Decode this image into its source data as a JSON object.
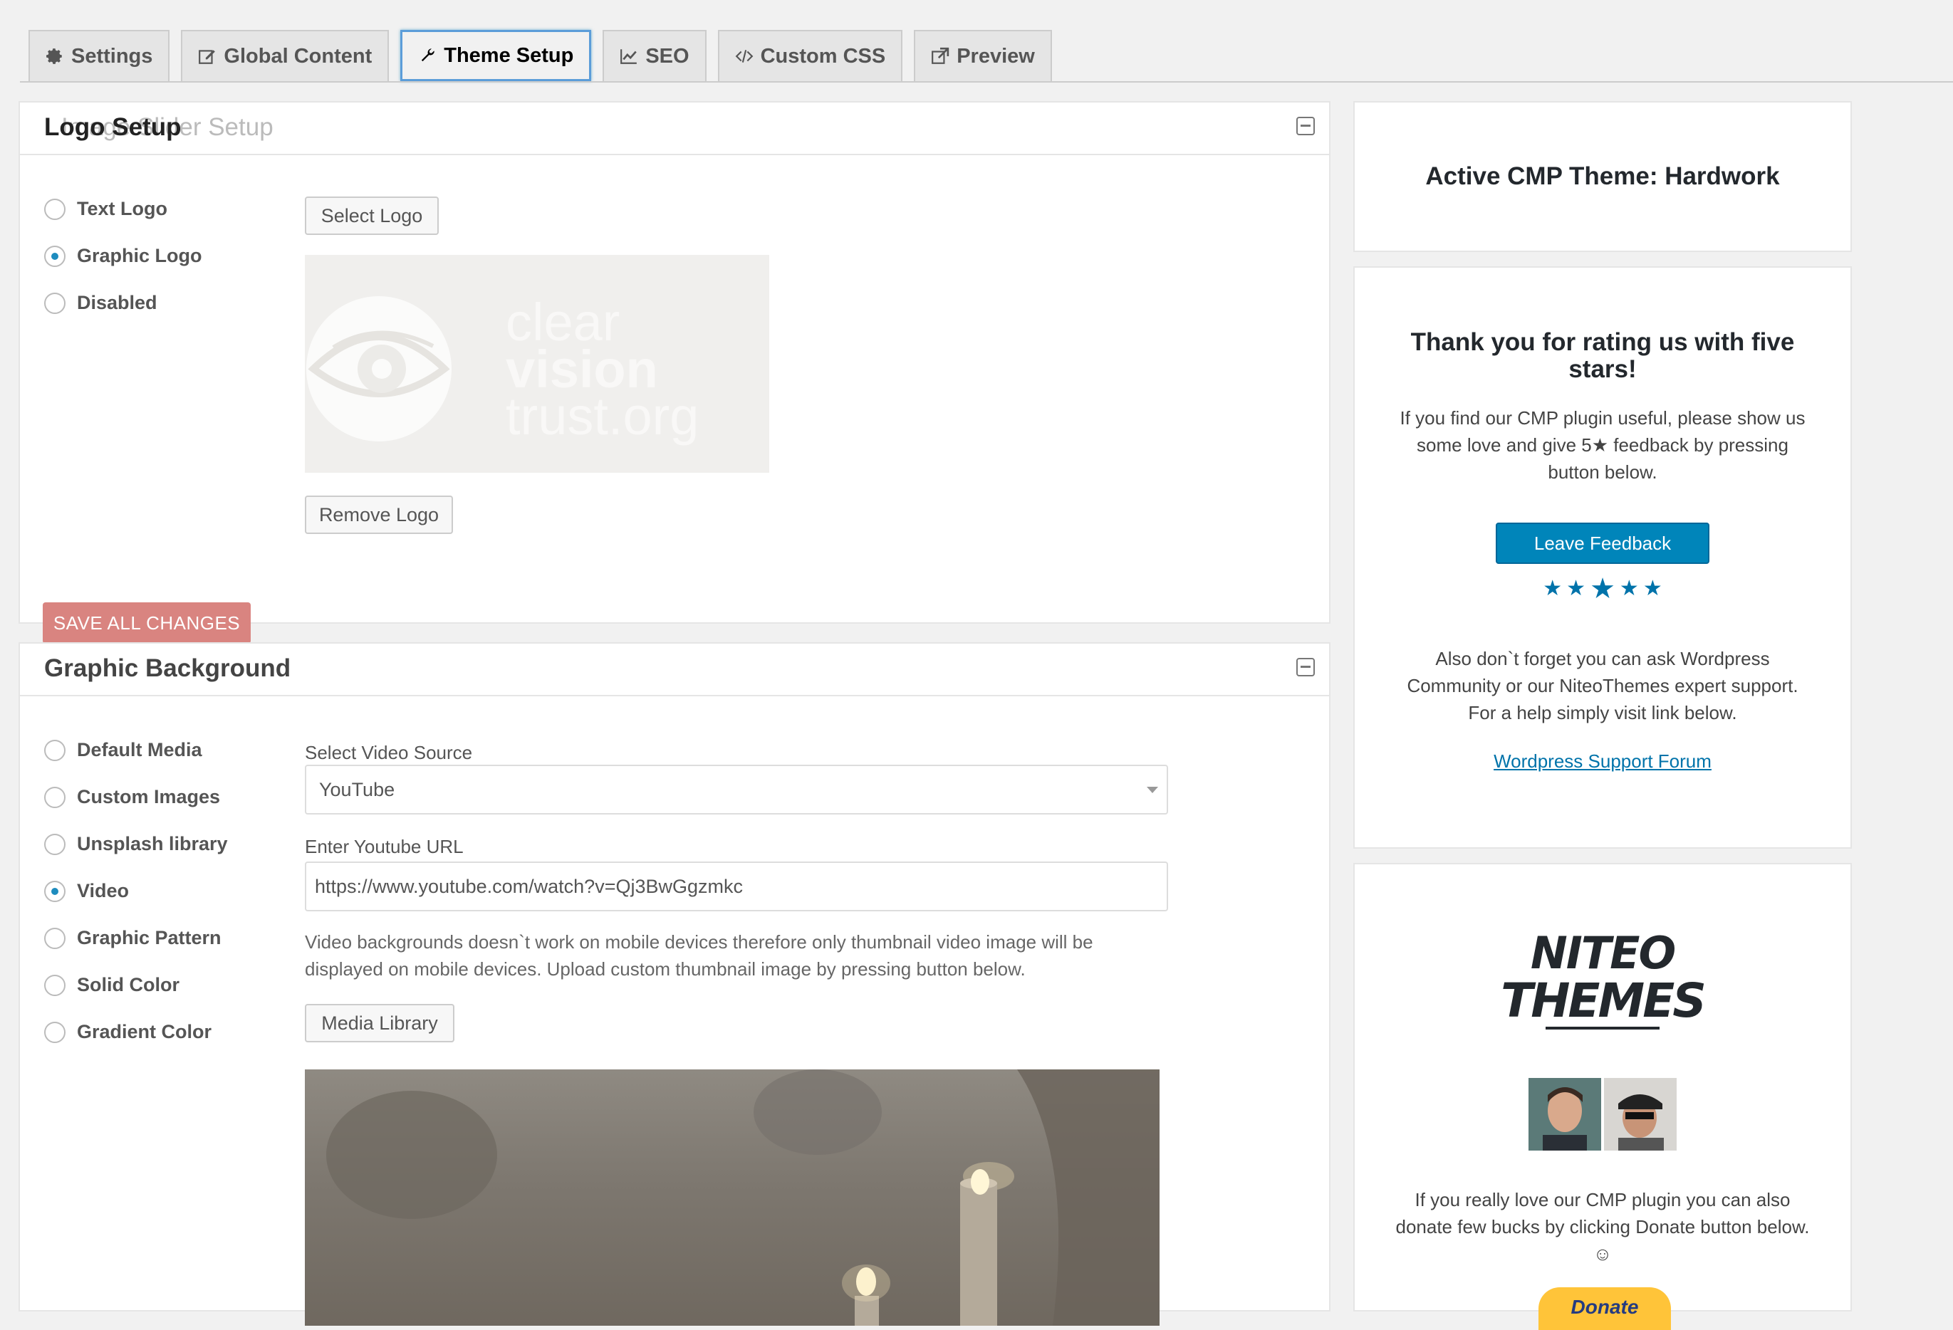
{
  "tabs": [
    {
      "label": "Settings",
      "icon": "gear-icon"
    },
    {
      "label": "Global Content",
      "icon": "edit-icon"
    },
    {
      "label": "Theme Setup",
      "icon": "wrench-icon",
      "active": true
    },
    {
      "label": "SEO",
      "icon": "chart-line-icon"
    },
    {
      "label": "Custom CSS",
      "icon": "code-icon"
    },
    {
      "label": "Preview",
      "icon": "external-link-icon"
    }
  ],
  "logo_panel": {
    "title": "Logo Setup",
    "ghost_title": "Image Slider Setup",
    "options": [
      "Text Logo",
      "Graphic Logo",
      "Disabled"
    ],
    "selected": "Graphic Logo",
    "select_button": "Select Logo",
    "logo_text": [
      "clear",
      "vision",
      "trust.org"
    ],
    "remove_button": "Remove Logo",
    "save_button": "SAVE ALL CHANGES"
  },
  "background_panel": {
    "title": "Graphic Background",
    "options": [
      "Default Media",
      "Custom Images",
      "Unsplash library",
      "Video",
      "Graphic Pattern",
      "Solid Color",
      "Gradient Color"
    ],
    "selected": "Video",
    "video_source_label": "Select Video Source",
    "video_source_value": "YouTube",
    "youtube_label": "Enter Youtube URL",
    "youtube_url": "https://www.youtube.com/watch?v=Qj3BwGgzmkc",
    "hint": "Video backgrounds doesn`t work on mobile devices therefore only thumbnail video image will be displayed on mobile devices. Upload custom thumbnail image by pressing button below.",
    "media_button": "Media Library"
  },
  "sidebar": {
    "active_theme": "Active CMP Theme: Hardwork",
    "rating": {
      "title": "Thank you for rating us with five stars!",
      "text": "If you find our CMP plugin useful, please show us some love and give 5★ feedback by pressing button below.",
      "button": "Leave Feedback",
      "stars": 5,
      "support_text": "Also don`t forget you can ask Wordpress Community or our NiteoThemes expert support. For a help simply visit link below.",
      "support_link": "Wordpress Support Forum"
    },
    "donate": {
      "logo_line1": "NITEO",
      "logo_line2": "THEMES",
      "text": "If you really love our CMP plugin you can also donate few bucks by clicking Donate button below. ☺",
      "button": "Donate"
    }
  },
  "colors": {
    "accent": "#0085ba",
    "save_button": "#d98480",
    "active_tab_border": "#5b9dd9",
    "radio_checked": "#1e8cbe"
  }
}
